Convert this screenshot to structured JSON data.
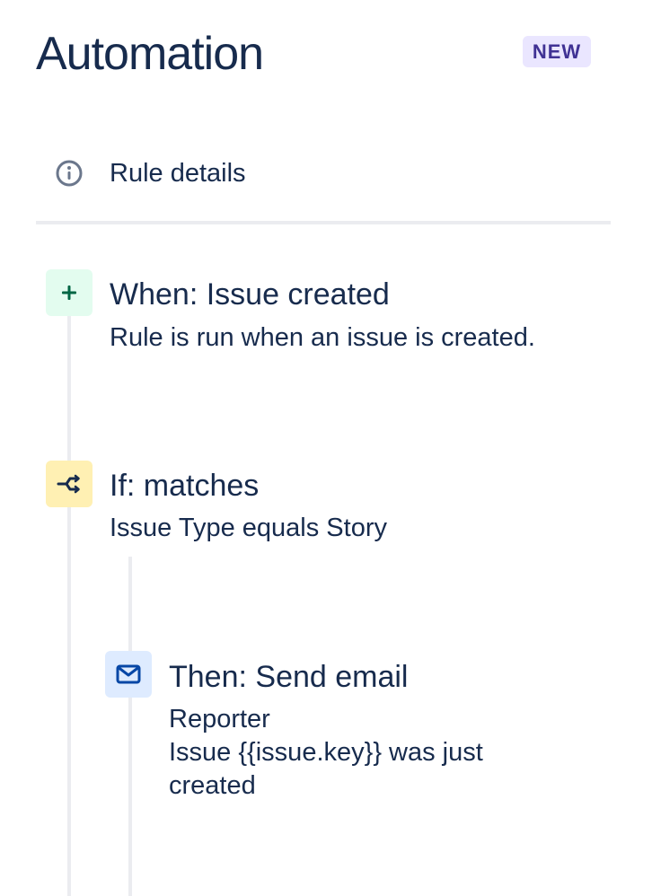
{
  "header": {
    "title": "Automation",
    "badge": "NEW"
  },
  "rule_details": {
    "icon": "info-icon",
    "label": "Rule details"
  },
  "steps": [
    {
      "type": "trigger",
      "icon": "plus-icon",
      "icon_color": "#006644",
      "icon_bg": "#e3fcef",
      "title": "When: Issue created",
      "description": "Rule is run when an issue is created."
    },
    {
      "type": "condition",
      "icon": "branch-icon",
      "icon_color": "#172b4d",
      "icon_bg": "#fff0b3",
      "title": "If: matches",
      "description": "Issue Type equals Story"
    },
    {
      "type": "action",
      "icon": "email-icon",
      "icon_color": "#0747a6",
      "icon_bg": "#deebff",
      "title": "Then: Send email",
      "description_lines": [
        "Reporter",
        "Issue {{issue.key}} was just",
        "created"
      ]
    }
  ],
  "colors": {
    "text": "#172b4d",
    "badge_bg": "#eae6ff",
    "badge_text": "#403294",
    "divider": "#ebecf0"
  }
}
